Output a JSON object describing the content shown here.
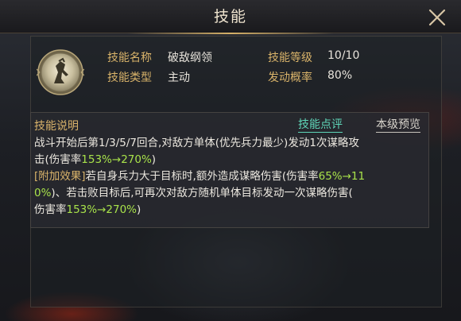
{
  "header": {
    "title": "技能"
  },
  "skill": {
    "name_label": "技能名称",
    "name_value": "破敌纲领",
    "level_label": "技能等级",
    "level_value": "10/10",
    "type_label": "技能类型",
    "type_value": "主动",
    "chance_label": "发动概率",
    "chance_value": "80%"
  },
  "description": {
    "heading": "技能说明",
    "review_link": "技能点评",
    "preview_link": "本级预览",
    "line1": "战斗开始后第1/3/5/7回合,对敌方单体(优先兵力最少)发动1次谋略攻",
    "line2_prefix": "击(伤害率",
    "line2_value": "153%→270%",
    "line2_suffix": ")",
    "line3_tag": "[附加效果]",
    "line3_text": "若自身兵力大于目标时,额外造成谋略伤害(伤害率",
    "line3_value": "65%→11",
    "line4_value": "0%",
    "line4_text": ")、若击败目标后,可再次对敌方随机单体目标发动一次谋略伤害(",
    "line5_prefix": "伤害率",
    "line5_value": "153%→270%",
    "line5_suffix": ")"
  },
  "icons": {
    "close": "close-icon",
    "skill": "skill-icon"
  },
  "colors": {
    "label_gold": "#d9b36a",
    "value_green": "#a8e24a",
    "link_teal": "#5fd6b8"
  }
}
